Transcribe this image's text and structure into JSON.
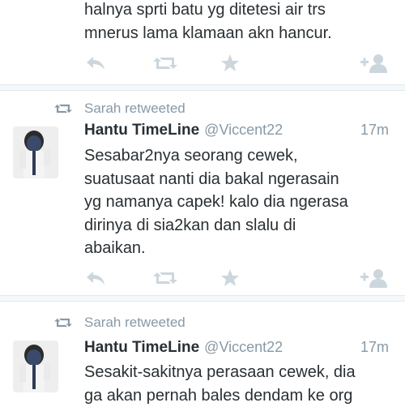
{
  "top_tweet": {
    "text_lines": "halnya sprti batu yg ditetesi air trs\nmnerus lama klamaan akn hancur."
  },
  "tweets": [
    {
      "retweeted_by": "Sarah retweeted",
      "name": "Hantu TimeLine",
      "handle": "@Viccent22",
      "time": "17m",
      "text": "Sesabar2nya seorang cewek,\nsuatusaat nanti dia bakal ngerasain\nyg namanya capek! kalo dia ngerasa\ndirinya di sia2kan dan slalu di\nabaikan."
    },
    {
      "retweeted_by": "Sarah retweeted",
      "name": "Hantu TimeLine",
      "handle": "@Viccent22",
      "time": "17m",
      "text": "Sesakit-sakitnya perasaan cewek, dia\nga akan pernah bales dendam ke org"
    }
  ],
  "icons": {
    "reply": "reply-icon",
    "retweet": "retweet-icon",
    "favorite": "star-icon",
    "follow": "follow-icon"
  },
  "colors": {
    "icon_gray": "#ccd6dd",
    "meta_gray": "#8899a6",
    "text": "#292f33"
  }
}
